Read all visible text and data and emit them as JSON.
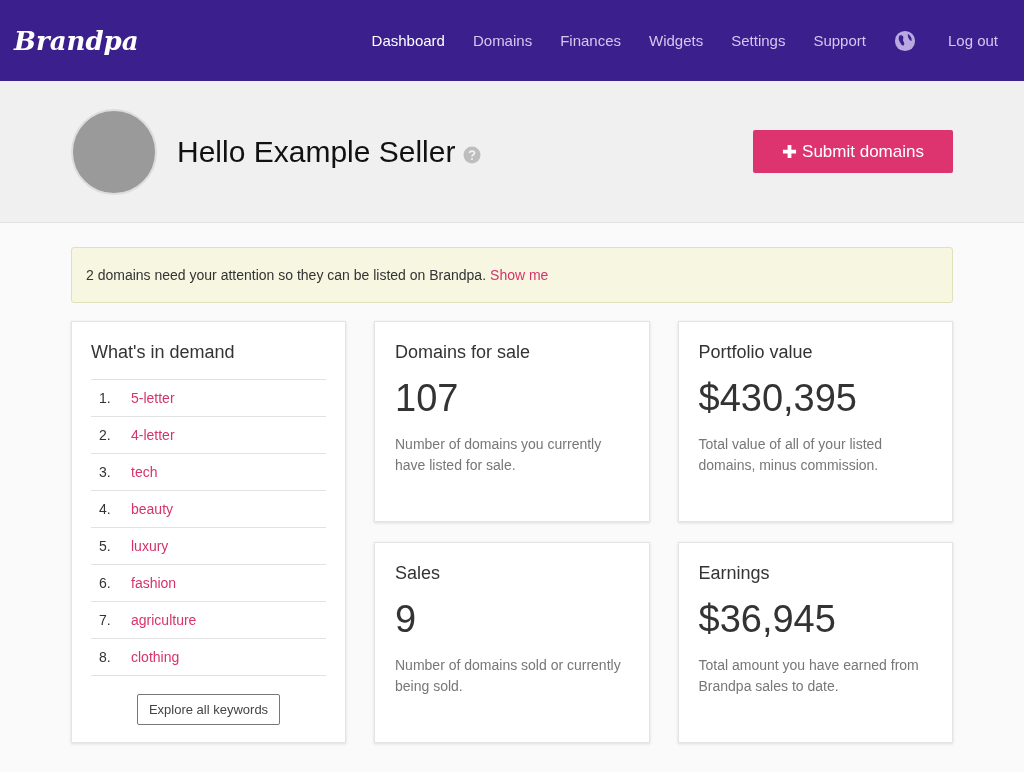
{
  "header": {
    "logo": "Brandpa",
    "nav": [
      {
        "label": "Dashboard",
        "selected": true
      },
      {
        "label": "Domains",
        "selected": false
      },
      {
        "label": "Finances",
        "selected": false
      },
      {
        "label": "Widgets",
        "selected": false
      },
      {
        "label": "Settings",
        "selected": false
      },
      {
        "label": "Support",
        "selected": false
      }
    ],
    "logout": "Log out"
  },
  "hero": {
    "greeting": "Hello Example Seller",
    "button": "Submit domains"
  },
  "alert": {
    "message": "2 domains need your attention so they can be listed on Brandpa.",
    "link": "Show me"
  },
  "demand": {
    "title": "What's in demand",
    "items": [
      {
        "number": "1.",
        "keyword": "5-letter"
      },
      {
        "number": "2.",
        "keyword": "4-letter"
      },
      {
        "number": "3.",
        "keyword": "tech"
      },
      {
        "number": "4.",
        "keyword": "beauty"
      },
      {
        "number": "5.",
        "keyword": "luxury"
      },
      {
        "number": "6.",
        "keyword": "fashion"
      },
      {
        "number": "7.",
        "keyword": "agriculture"
      },
      {
        "number": "8.",
        "keyword": "clothing"
      }
    ],
    "button": "Explore all keywords"
  },
  "stats": [
    {
      "title": "Domains for sale",
      "value": "107",
      "description": "Number of domains you currently have listed for sale."
    },
    {
      "title": "Portfolio value",
      "value": "$430,395",
      "description": "Total value of all of your listed domains, minus commission."
    },
    {
      "title": "Sales",
      "value": "9",
      "description": "Number of domains sold or currently being sold."
    },
    {
      "title": "Earnings",
      "value": "$36,945",
      "description": "Total amount you have earned from Brandpa sales to date."
    }
  ]
}
